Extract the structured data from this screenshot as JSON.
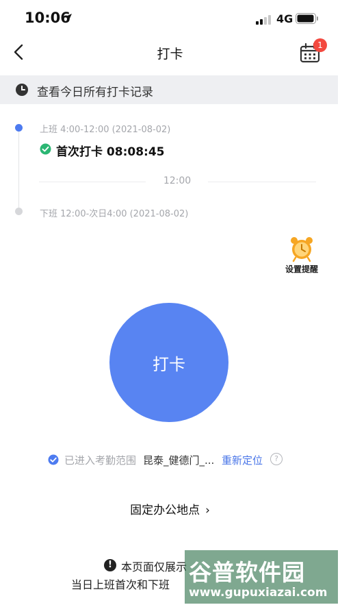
{
  "status_bar": {
    "time": "10:06",
    "network": "4G"
  },
  "nav": {
    "title": "打卡",
    "calendar_badge": "1"
  },
  "record_bar": {
    "text": "查看今日所有打卡记录"
  },
  "timeline": {
    "on_duty_label": "上班 4:00-12:00 (2021-08-02)",
    "first_checkin": "首次打卡 08:08:45",
    "separator": "12:00",
    "off_duty_label": "下班 12:00-次日4:00 (2021-08-02)"
  },
  "reminder": {
    "label": "设置提醒"
  },
  "punch_button": {
    "label": "打卡"
  },
  "range": {
    "prefix": "已进入考勤范围",
    "place": "昆泰_健德门_...",
    "relocate": "重新定位",
    "help": "?"
  },
  "fixed_office": {
    "label": "固定办公地点",
    "chevron": "›"
  },
  "notice": {
    "icon": "!",
    "line1": "本页面仅展示",
    "line2": "当日上班首次和下班"
  },
  "watermark": {
    "main": "谷普软件园",
    "url": "www.gupuxiazai.com"
  },
  "colors": {
    "accent": "#5884f2",
    "success": "#2bb673",
    "badge": "#f3493f",
    "alarm": "#f6a623"
  }
}
